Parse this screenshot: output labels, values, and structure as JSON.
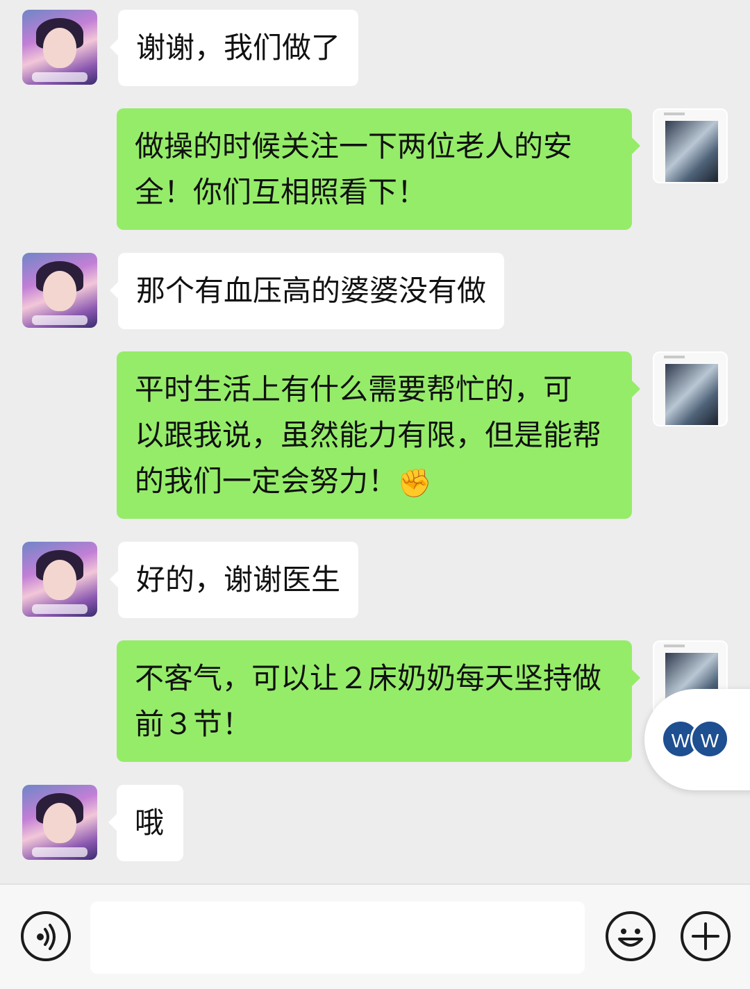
{
  "messages": [
    {
      "side": "left",
      "text": "谢谢，我们做了"
    },
    {
      "side": "right",
      "lines": [
        "做操的时候关注一下两位老人的安",
        "全！你们互相照看下！"
      ]
    },
    {
      "side": "left",
      "text": "那个有血压高的婆婆没有做"
    },
    {
      "side": "right",
      "lines": [
        "平时生活上有什么需要帮忙的，可",
        "以跟我说，虽然能力有限，但是能帮",
        "的我们一定会努力！"
      ],
      "emoji": "✊"
    },
    {
      "side": "left",
      "text": "好的，谢谢医生"
    },
    {
      "side": "right",
      "lines": [
        "不客气，可以让２床奶奶每天坚持做",
        "前３节！"
      ]
    },
    {
      "side": "left",
      "text": "哦"
    }
  ],
  "floating_widget": {
    "letters": [
      "W",
      "W"
    ]
  },
  "input_bar": {
    "voice_icon": "voice-icon",
    "emoji_icon": "emoji-icon",
    "add_icon": "plus-icon",
    "input_value": ""
  },
  "colors": {
    "background": "#ededed",
    "outgoing_bubble": "#95ec69",
    "incoming_bubble": "#ffffff",
    "widget_badge": "#1d4f91"
  }
}
